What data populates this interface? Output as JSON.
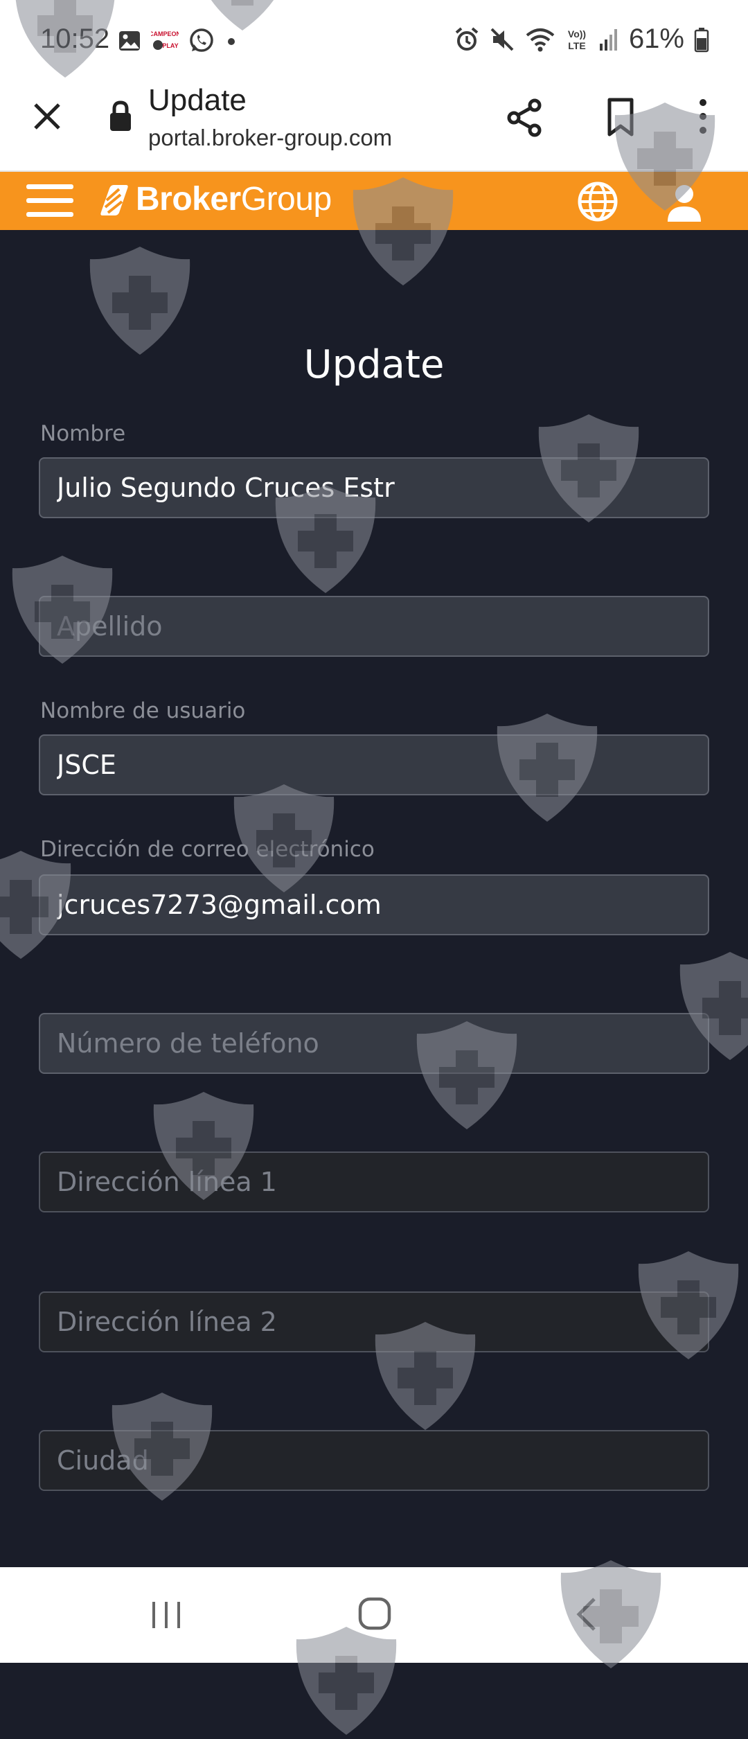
{
  "status_bar": {
    "time": "10:52",
    "battery": "61%",
    "left_icons": [
      "gallery-icon",
      "campeon-play-icon",
      "whatsapp-icon",
      "dot-icon"
    ],
    "right_icons": [
      "alarm-icon",
      "mute-icon",
      "wifi-icon",
      "volte-icon",
      "signal-icon",
      "battery-icon"
    ]
  },
  "browser": {
    "title": "Update",
    "url": "portal.broker-group.com"
  },
  "header": {
    "logo_bold": "Broker",
    "logo_light": "Group"
  },
  "form": {
    "title": "Update",
    "fields": {
      "first_name": {
        "label": "Nombre",
        "value": "Julio Segundo Cruces Estr"
      },
      "last_name": {
        "placeholder": "Apellido"
      },
      "username": {
        "label": "Nombre de usuario",
        "value": "JSCE"
      },
      "email": {
        "label": "Dirección de correo electrónico",
        "value": "jcruces7273@gmail.com"
      },
      "phone": {
        "placeholder": "Número de teléfono"
      },
      "address1": {
        "placeholder": "Dirección línea 1"
      },
      "address2": {
        "placeholder": "Dirección línea 2"
      },
      "city": {
        "placeholder": "Ciudad"
      }
    }
  },
  "colors": {
    "header_orange": "#f7941d",
    "page_bg": "#1a1d29",
    "input_bg": "#363a44",
    "input_bg_dark": "#222429"
  }
}
